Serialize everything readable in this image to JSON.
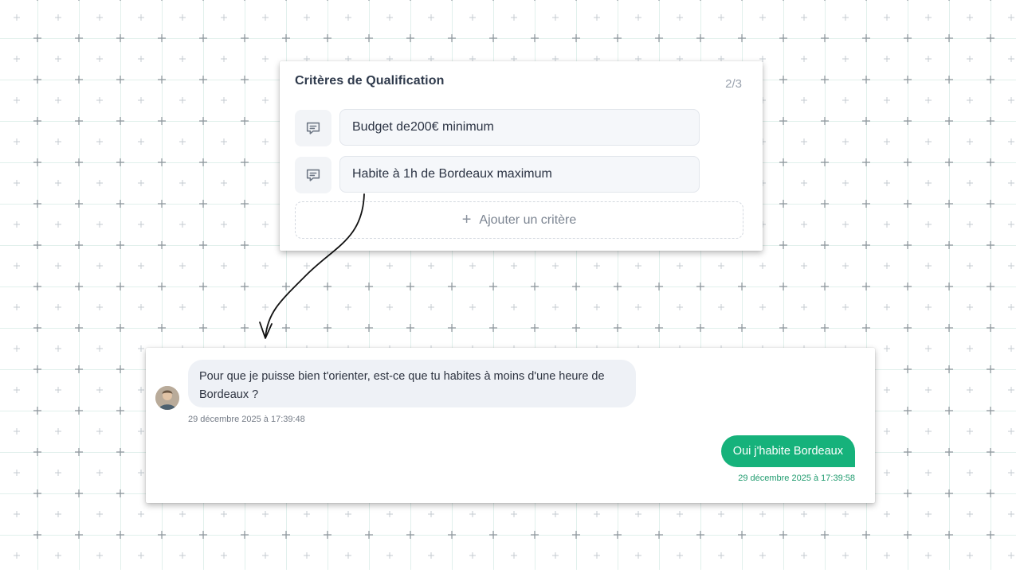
{
  "criteria": {
    "title": "Critères de Qualification",
    "counter": "2/3",
    "items": [
      {
        "icon": "message-square-icon",
        "label": "Budget de200€ minimum"
      },
      {
        "icon": "message-square-icon",
        "label": "Habite à 1h de Bordeaux maximum"
      }
    ],
    "add_button": {
      "icon": "plus-icon",
      "label": "Ajouter un critère"
    }
  },
  "chat": {
    "incoming": {
      "text": "Pour que je puisse bien t'orienter, est-ce que tu habites à moins d'une heure de Bordeaux ?",
      "timestamp": "29 décembre 2025 à 17:39:48"
    },
    "outgoing": {
      "text": "Oui j'habite Bordeaux",
      "timestamp": "29 décembre 2025 à 17:39:58"
    }
  },
  "colors": {
    "accent_green": "#16b27b",
    "incoming_bubble": "#eef1f6",
    "grid_line": "#d8ece6"
  }
}
